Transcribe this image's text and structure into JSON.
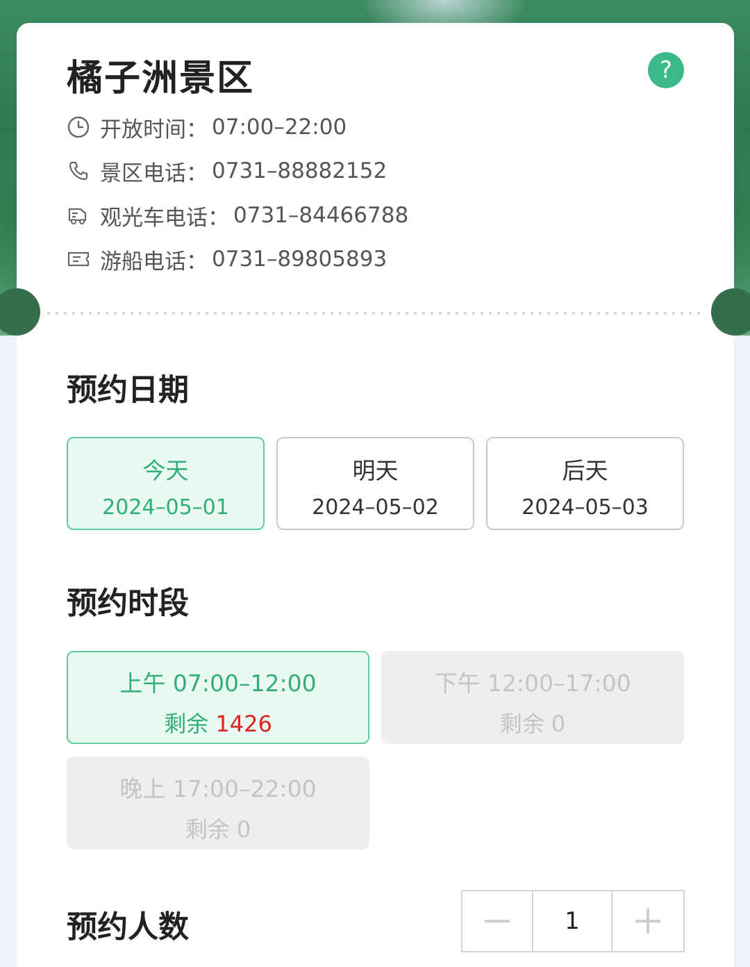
{
  "scenic": {
    "title": "橘子洲景区",
    "help": "?",
    "rows": [
      {
        "icon": "clock-icon",
        "label": "开放时间：",
        "value": "07:00–22:00"
      },
      {
        "icon": "phone-icon",
        "label": "景区电话：",
        "value": "0731–88882152"
      },
      {
        "icon": "tour-bus-icon",
        "label": "观光车电话：",
        "value": "0731–84466788"
      },
      {
        "icon": "ticket-icon",
        "label": "游船电话：",
        "value": "0731–89805893"
      }
    ]
  },
  "date_section": {
    "title": "预约日期",
    "options": [
      {
        "day": "今天",
        "date": "2024–05–01",
        "selected": true
      },
      {
        "day": "明天",
        "date": "2024–05–02",
        "selected": false
      },
      {
        "day": "后天",
        "date": "2024–05–03",
        "selected": false
      }
    ]
  },
  "time_section": {
    "title": "预约时段",
    "remaining_label": "剩余",
    "slots": [
      {
        "label": "上午 07:00–12:00",
        "remaining": "1426",
        "selected": true,
        "disabled": false
      },
      {
        "label": "下午 12:00–17:00",
        "remaining": "0",
        "selected": false,
        "disabled": true
      },
      {
        "label": "晚上 17:00–22:00",
        "remaining": "0",
        "selected": false,
        "disabled": true
      }
    ]
  },
  "people_section": {
    "title": "预约人数",
    "count": "1"
  },
  "colors": {
    "accent": "#3cb988",
    "selected_bg": "#eafaf2",
    "remaining_red": "#d8241e"
  }
}
